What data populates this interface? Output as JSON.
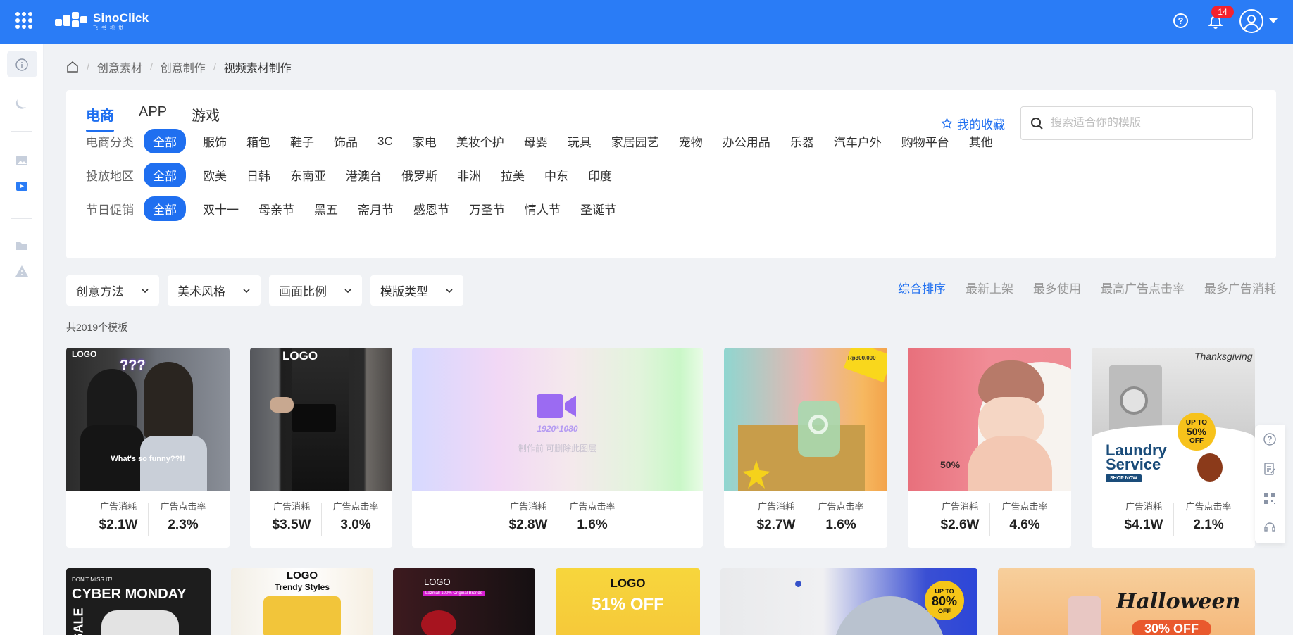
{
  "app": {
    "name": "SinoClick",
    "subtitle": "飞书视觉",
    "notifications": "14"
  },
  "breadcrumb": [
    "创意素材",
    "创意制作",
    "视频素材制作"
  ],
  "tabs": [
    "电商",
    "APP",
    "游戏"
  ],
  "favorites_label": "我的收藏",
  "search": {
    "placeholder": "搜索适合你的模版",
    "value": ""
  },
  "filters": {
    "category": {
      "label": "电商分类",
      "options": [
        "全部",
        "服饰",
        "箱包",
        "鞋子",
        "饰品",
        "3C",
        "家电",
        "美妆个护",
        "母婴",
        "玩具",
        "家居园艺",
        "宠物",
        "办公用品",
        "乐器",
        "汽车户外",
        "购物平台",
        "其他"
      ]
    },
    "region": {
      "label": "投放地区",
      "options": [
        "全部",
        "欧美",
        "日韩",
        "东南亚",
        "港澳台",
        "俄罗斯",
        "非洲",
        "拉美",
        "中东",
        "印度"
      ]
    },
    "festival": {
      "label": "节日促销",
      "options": [
        "全部",
        "双十一",
        "母亲节",
        "黑五",
        "斋月节",
        "感恩节",
        "万圣节",
        "情人节",
        "圣诞节"
      ]
    }
  },
  "dropdowns": [
    "创意方法",
    "美术风格",
    "画面比例",
    "模版类型"
  ],
  "sort": [
    "综合排序",
    "最新上架",
    "最多使用",
    "最高广告点击率",
    "最多广告消耗"
  ],
  "total": "共2019个模板",
  "stat_labels": {
    "spend": "广告消耗",
    "ctr": "广告点击率"
  },
  "cards": [
    {
      "spend": "$2.1W",
      "ctr": "2.3%",
      "logo": "LOGO",
      "caption": "What's so funny??!!",
      "sticker": "???"
    },
    {
      "spend": "$3.5W",
      "ctr": "3.0%",
      "logo": "LOGO"
    },
    {
      "spend": "$2.8W",
      "ctr": "1.6%",
      "size": "1920*1080",
      "hint": "制作前 可删除此图层"
    },
    {
      "spend": "$2.7W",
      "ctr": "1.6%",
      "price": "Rp300.000"
    },
    {
      "spend": "$2.6W",
      "ctr": "4.6%",
      "mark": "50%"
    },
    {
      "spend": "$4.1W",
      "ctr": "2.1%",
      "script": "Thanksgiving",
      "title1": "Laundry",
      "title2": "Service",
      "cta": "SHOP NOW",
      "promo1": "UP TO",
      "promo2": "50%",
      "promo3": "OFF"
    }
  ],
  "row2": [
    {
      "kicker": "DON'T MISS IT!",
      "title": "CYBER MONDAY",
      "side": "SALE"
    },
    {
      "logo": "LOGO",
      "sub": "Trendy Styles"
    },
    {
      "logo": "LOGO",
      "strip": "Lazmall 100% Original Brands"
    },
    {
      "logo": "LOGO",
      "offer": "51% OFF"
    },
    {
      "promo1": "UP TO",
      "promo2": "80%",
      "promo3": "OFF"
    },
    {
      "title": "Halloween",
      "offer": "30% OFF"
    }
  ],
  "colors": {
    "primary": "#2a7cf6",
    "accent": "#1f6ff0",
    "badge": "#f5222d"
  }
}
